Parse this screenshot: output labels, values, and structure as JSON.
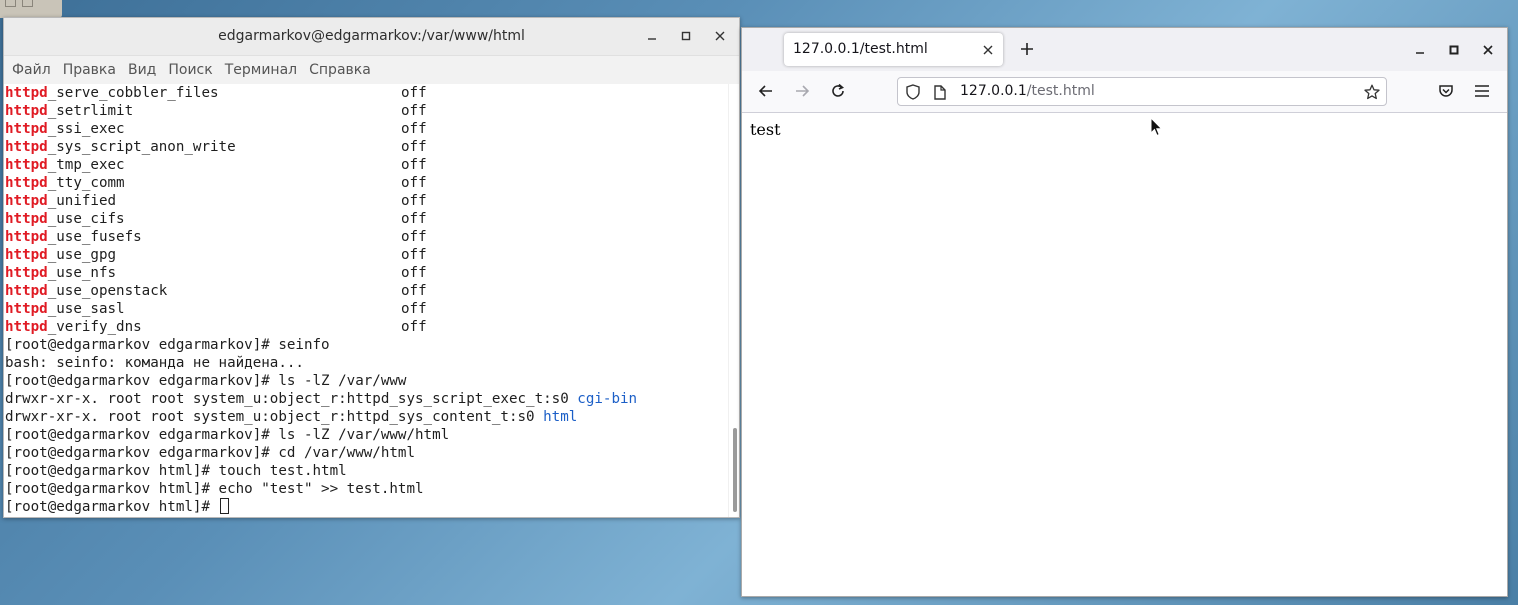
{
  "terminal": {
    "title": "edgarmarkov@edgarmarkov:/var/www/html",
    "menu": [
      "Файл",
      "Правка",
      "Вид",
      "Поиск",
      "Терминал",
      "Справка"
    ],
    "booleans": [
      {
        "prefix": "httpd",
        "name": "_serve_cobbler_files",
        "value": "off"
      },
      {
        "prefix": "httpd",
        "name": "_setrlimit",
        "value": "off"
      },
      {
        "prefix": "httpd",
        "name": "_ssi_exec",
        "value": "off"
      },
      {
        "prefix": "httpd",
        "name": "_sys_script_anon_write",
        "value": "off"
      },
      {
        "prefix": "httpd",
        "name": "_tmp_exec",
        "value": "off"
      },
      {
        "prefix": "httpd",
        "name": "_tty_comm",
        "value": "off"
      },
      {
        "prefix": "httpd",
        "name": "_unified",
        "value": "off"
      },
      {
        "prefix": "httpd",
        "name": "_use_cifs",
        "value": "off"
      },
      {
        "prefix": "httpd",
        "name": "_use_fusefs",
        "value": "off"
      },
      {
        "prefix": "httpd",
        "name": "_use_gpg",
        "value": "off"
      },
      {
        "prefix": "httpd",
        "name": "_use_nfs",
        "value": "off"
      },
      {
        "prefix": "httpd",
        "name": "_use_openstack",
        "value": "off"
      },
      {
        "prefix": "httpd",
        "name": "_use_sasl",
        "value": "off"
      },
      {
        "prefix": "httpd",
        "name": "_verify_dns",
        "value": "off"
      }
    ],
    "output": [
      {
        "text": "[root@edgarmarkov edgarmarkov]# seinfo",
        "dir": ""
      },
      {
        "text": "bash: seinfo: команда не найдена...",
        "dir": ""
      },
      {
        "text": "[root@edgarmarkov edgarmarkov]# ls -lZ /var/www",
        "dir": ""
      },
      {
        "text": "drwxr-xr-x. root root system_u:object_r:httpd_sys_script_exec_t:s0 ",
        "dir": "cgi-bin"
      },
      {
        "text": "drwxr-xr-x. root root system_u:object_r:httpd_sys_content_t:s0 ",
        "dir": "html"
      },
      {
        "text": "[root@edgarmarkov edgarmarkov]# ls -lZ /var/www/html",
        "dir": ""
      },
      {
        "text": "[root@edgarmarkov edgarmarkov]# cd /var/www/html",
        "dir": ""
      },
      {
        "text": "[root@edgarmarkov html]# touch test.html",
        "dir": ""
      },
      {
        "text": "[root@edgarmarkov html]# echo \"test\" >> test.html",
        "dir": ""
      }
    ],
    "prompt": "[root@edgarmarkov html]# "
  },
  "browser": {
    "tab_title": "127.0.0.1/test.html",
    "url_host": "127.0.0.1",
    "url_path": "/test.html",
    "page_text": "test"
  }
}
